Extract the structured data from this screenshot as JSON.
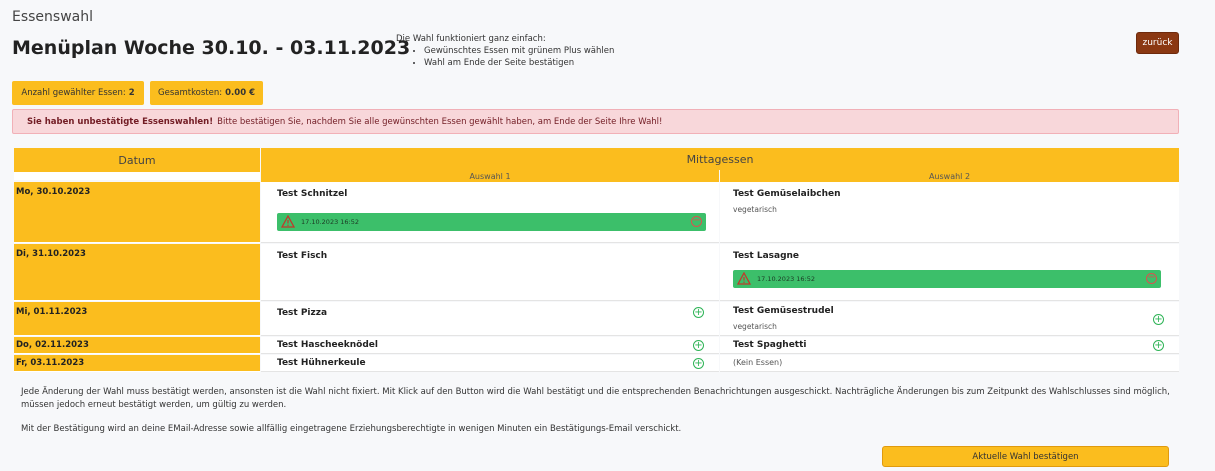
{
  "app_title": "Essenswahl",
  "page_title": "Menüplan Woche 30.10. - 03.11.2023",
  "instructions": {
    "intro": "Die Wahl funktioniert ganz einfach:",
    "steps": [
      "Gewünschtes Essen mit grünem Plus wählen",
      "Wahl am Ende der Seite bestätigen"
    ]
  },
  "back_label": "zurück",
  "stats": {
    "count_label": "Anzahl gewählter Essen:",
    "count_value": "2",
    "cost_label": "Gesamtkosten:",
    "cost_value": "0.00 €"
  },
  "alert": {
    "bold": "Sie haben unbestätigte Essenswahlen!",
    "text": "Bitte bestätigen Sie, nachdem Sie alle gewünschten Essen gewählt haben, am Ende der Seite Ihre Wahl!"
  },
  "table": {
    "col_date": "Datum",
    "col_lunch": "Mittagessen",
    "sub_1": "Auswahl 1",
    "sub_2": "Auswahl 2",
    "rows": [
      {
        "date": "Mo, 30.10.2023",
        "opt1": {
          "name": "Test Schnitzel",
          "selected_timestamp": "17.10.2023 16:52"
        },
        "opt2": {
          "name": "Test Gemüselaibchen",
          "note": "vegetarisch"
        }
      },
      {
        "date": "Di, 31.10.2023",
        "opt1": {
          "name": "Test Fisch"
        },
        "opt2": {
          "name": "Test Lasagne",
          "selected_timestamp": "17.10.2023 16:52"
        }
      },
      {
        "date": "Mi, 01.11.2023",
        "opt1": {
          "name": "Test Pizza"
        },
        "opt2": {
          "name": "Test Gemüsestrudel",
          "note": "vegetarisch"
        }
      },
      {
        "date": "Do, 02.11.2023",
        "opt1": {
          "name": "Test Hascheeknödel"
        },
        "opt2": {
          "name": "Test Spaghetti"
        }
      },
      {
        "date": "Fr, 03.11.2023",
        "opt1": {
          "name": "Test Hühnerkeule"
        },
        "opt2": {
          "name": "(Kein Essen)"
        }
      }
    ]
  },
  "notice_1": "Jede Änderung der Wahl muss bestätigt werden, ansonsten ist die Wahl nicht fixiert. Mit Klick auf den Button wird die Wahl bestätigt und die entsprechenden Benachrichtungen ausgeschickt. Nachträgliche Änderungen bis zum Zeitpunkt des Wahlschlusses sind möglich, müssen jedoch erneut bestätigt werden, um gültig zu werden.",
  "notice_2": "Mit der Bestätigung wird an deine EMail-Adresse sowie allfällig eingetragene Erziehungsberechtigte in wenigen Minuten ein Bestätigungs-Email verschickt.",
  "confirm_label": "Aktuelle Wahl bestätigen",
  "colors": {
    "accent": "#fbbd1e",
    "selected": "#3cbf6a",
    "back_button": "#8b3812",
    "alert_bg": "#f8d7da"
  }
}
